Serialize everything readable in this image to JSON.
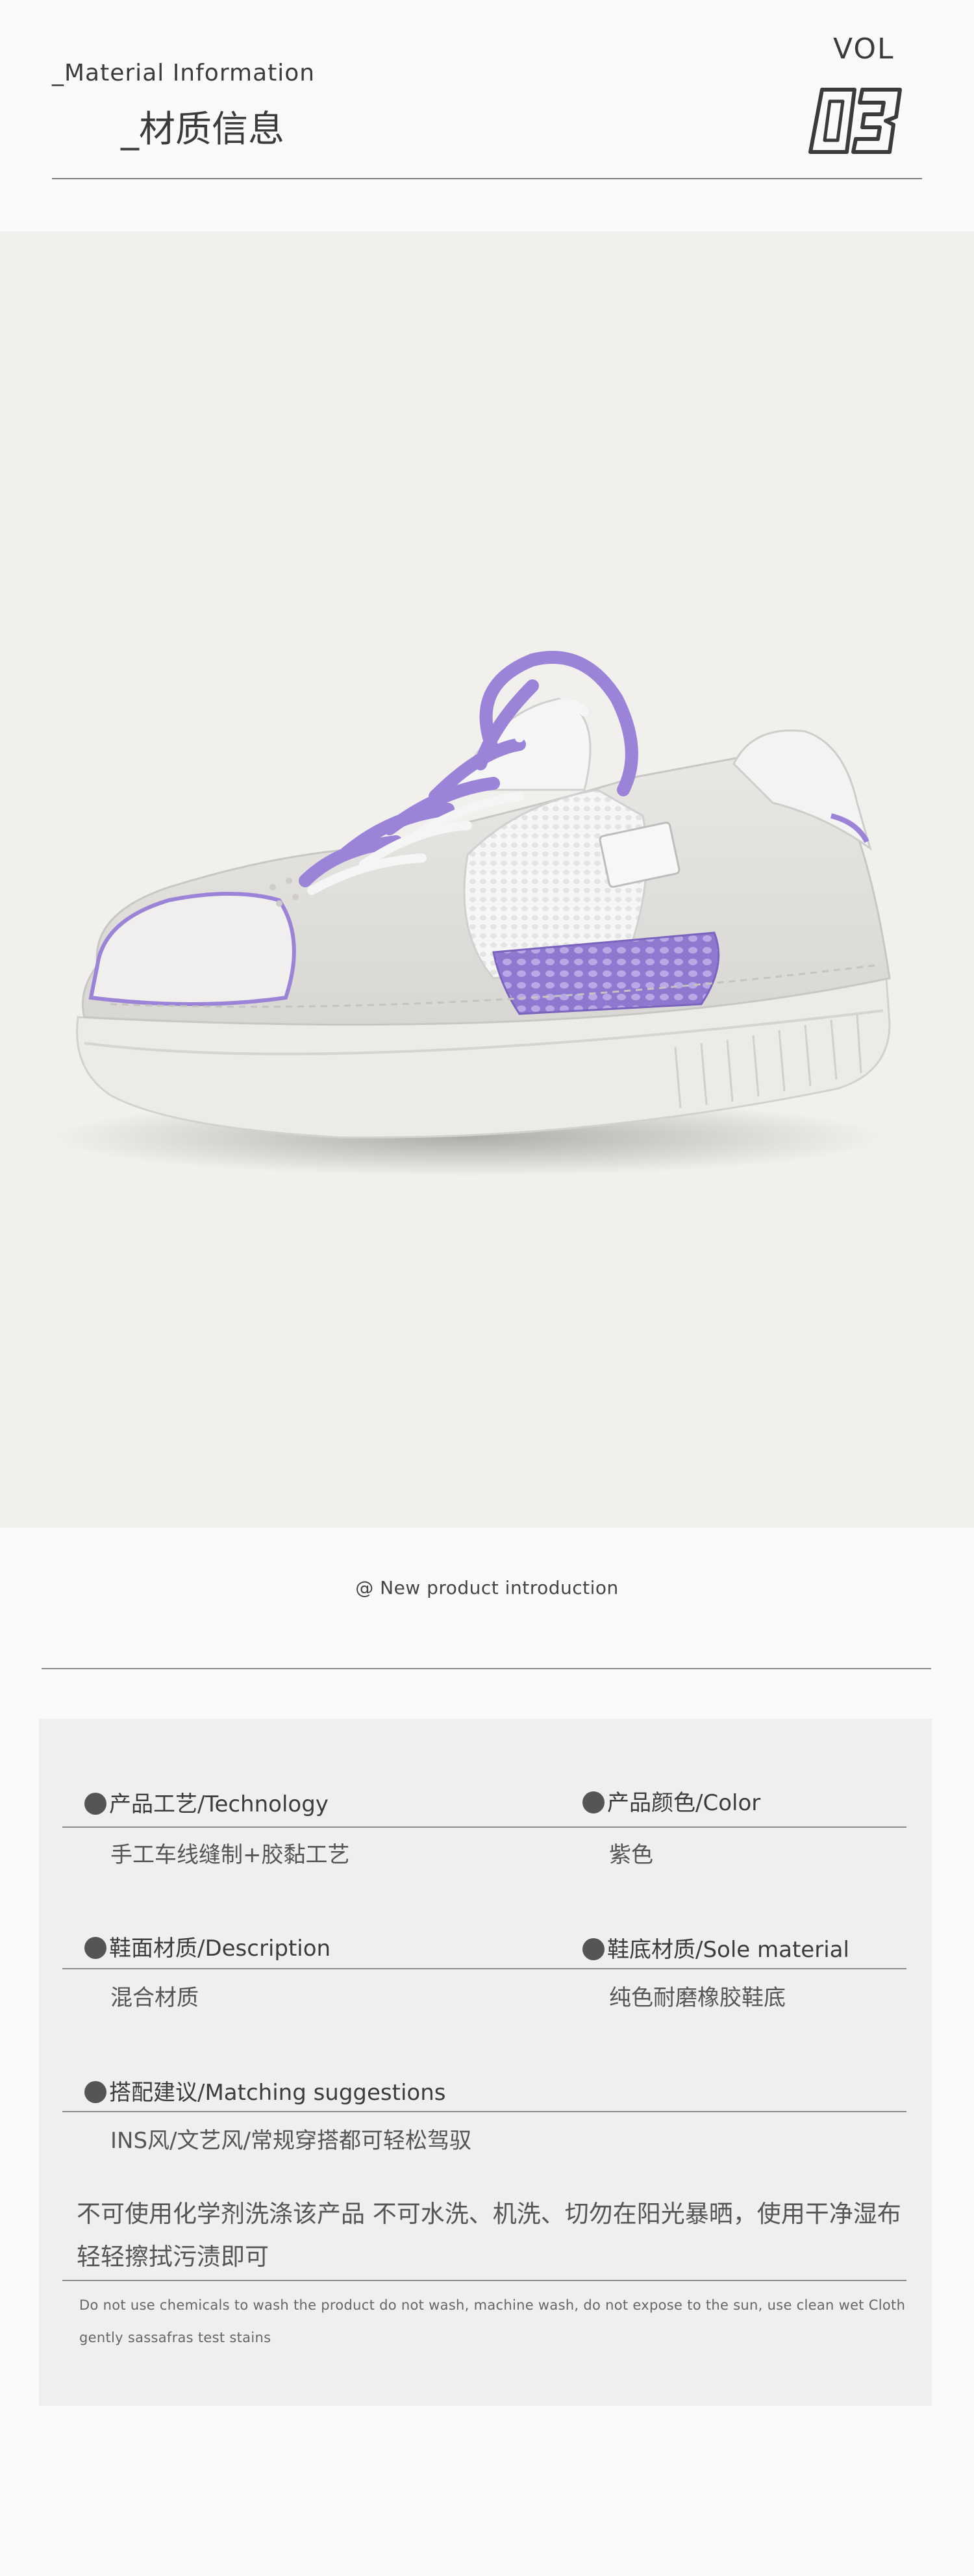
{
  "header": {
    "title_en": "_Material Information",
    "title_cn": "_材质信息",
    "vol_label": "VOL",
    "vol_number": "03"
  },
  "photo": {
    "description_icon": "purple-white-sneaker-image",
    "background_color": "#f2f0ed",
    "accent_color": "#9b84d8"
  },
  "caption": "@ New product introduction",
  "specs": {
    "technology_label": "产品工艺/Technology",
    "technology_value": "手工车线缝制+胶黏工艺",
    "color_label": "产品颜色/Color",
    "color_value": "紫色",
    "upper_label": "鞋面材质/Description",
    "upper_value": "混合材质",
    "sole_label": "鞋底材质/Sole material",
    "sole_value": "纯色耐磨橡胶鞋底",
    "matching_label": "搭配建议/Matching suggestions",
    "matching_value": "INS风/文艺风/常规穿搭都可轻松驾驭"
  },
  "care": {
    "cn": "不可使用化学剂洗涤该产品 不可水洗、机洗、切勿在阳光暴晒，使用干净湿布轻轻擦拭污渍即可",
    "en": "Do not use chemicals to wash the product do not wash, machine wash, do not expose to the sun, use clean wet Cloth gently sassafras test stains"
  }
}
